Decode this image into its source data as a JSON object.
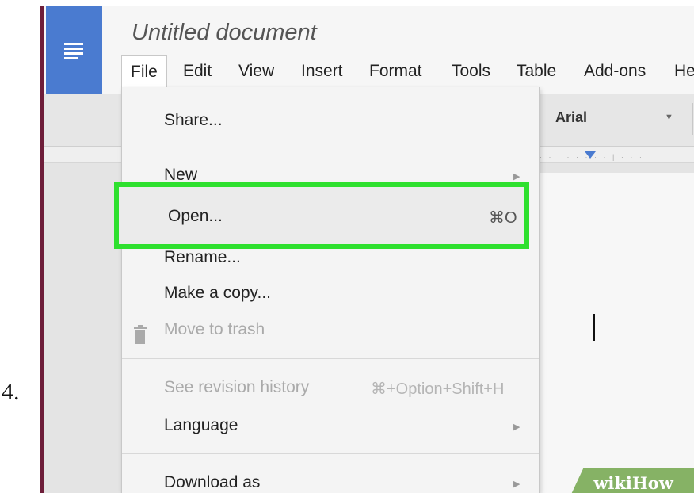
{
  "step": {
    "number": "4."
  },
  "app": {
    "title": "Untitled document",
    "menubar": [
      "File",
      "Edit",
      "View",
      "Insert",
      "Format",
      "Tools",
      "Table",
      "Add-ons",
      "He"
    ],
    "toolbar": {
      "font": "Arial"
    }
  },
  "file_menu": {
    "items": [
      {
        "label": "Share...",
        "enabled": true
      },
      {
        "label": "New",
        "submenu": true,
        "enabled": true
      },
      {
        "label": "Open...",
        "shortcut": "⌘O",
        "enabled": true,
        "highlighted": true
      },
      {
        "label": "Rename...",
        "enabled": true
      },
      {
        "label": "Make a copy...",
        "enabled": true
      },
      {
        "label": "Move to trash",
        "icon": "trash-icon",
        "enabled": false
      },
      {
        "label": "See revision history",
        "shortcut": "⌘+Option+Shift+H",
        "enabled": false
      },
      {
        "label": "Language",
        "submenu": true,
        "enabled": true
      },
      {
        "label": "Download as",
        "submenu": true,
        "enabled": true
      }
    ]
  },
  "watermark": {
    "text": "wikiHow"
  },
  "colors": {
    "accent_blue": "#4a7bd0",
    "highlight_green": "#2ee02e",
    "watermark_green": "#86b265"
  }
}
